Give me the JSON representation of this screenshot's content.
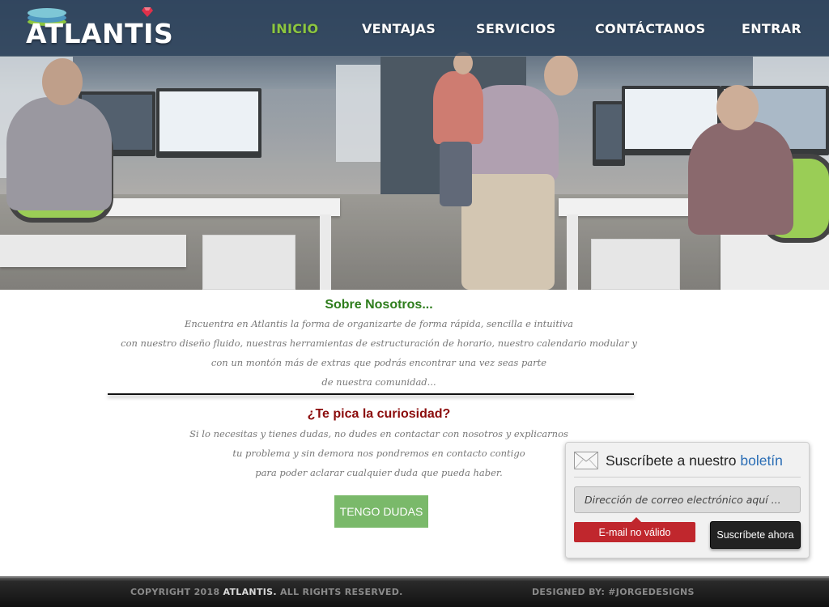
{
  "brand": {
    "logo_text": "ATLANTIS"
  },
  "nav": {
    "items": [
      {
        "label": "INICIO",
        "active": true
      },
      {
        "label": "VENTAJAS"
      },
      {
        "label": "SERVICIOS"
      },
      {
        "label": "CONTÁCTANOS"
      },
      {
        "label": "ENTRAR"
      }
    ]
  },
  "hero": {
    "image": "office-photo"
  },
  "about": {
    "title": "Sobre Nosotros...",
    "lines": [
      "Encuentra en Atlantis la forma de organizarte de forma rápida, sencilla e intuitiva",
      "con nuestro diseño fluido, nuestras herramientas de estructuración de horario, nuestro calendario modular y",
      "con un montón más de extras que podrás encontrar una vez seas parte",
      "de nuestra comunidad..."
    ]
  },
  "curiosity": {
    "title": "¿Te pica la curiosidad?",
    "lines": [
      "Si lo necesitas y tienes dudas, no dudes en contactar con nosotros y explicarnos",
      "tu problema y sin demora nos pondremos en contacto contigo",
      "para poder aclarar cualquier duda que pueda haber."
    ],
    "button": "TENGO DUDAS"
  },
  "newsletter": {
    "title_prefix": "Suscríbete a nuestro",
    "title_highlight": "boletín",
    "email_placeholder": "Dirección de correo electrónico aquí ...",
    "error": "E-mail no válido",
    "submit": "Suscríbete ahora",
    "icon": "envelope-icon"
  },
  "footer": {
    "copyright_prefix": "COPYRIGHT 2018",
    "copyright_brand": "ATLANTIS.",
    "copyright_suffix": "ALL RIGHTS RESERVED.",
    "designed_by": "DESIGNED BY: #JORGEDESIGNS"
  },
  "colors": {
    "nav_bg": "#293f58",
    "nav_active": "#8cc63f",
    "about_title": "#2e7d1c",
    "curiosity_title": "#8b0c0c",
    "cta_bg": "#7ab96a",
    "error_bg": "#c0272d",
    "link_blue": "#2a6db5"
  }
}
